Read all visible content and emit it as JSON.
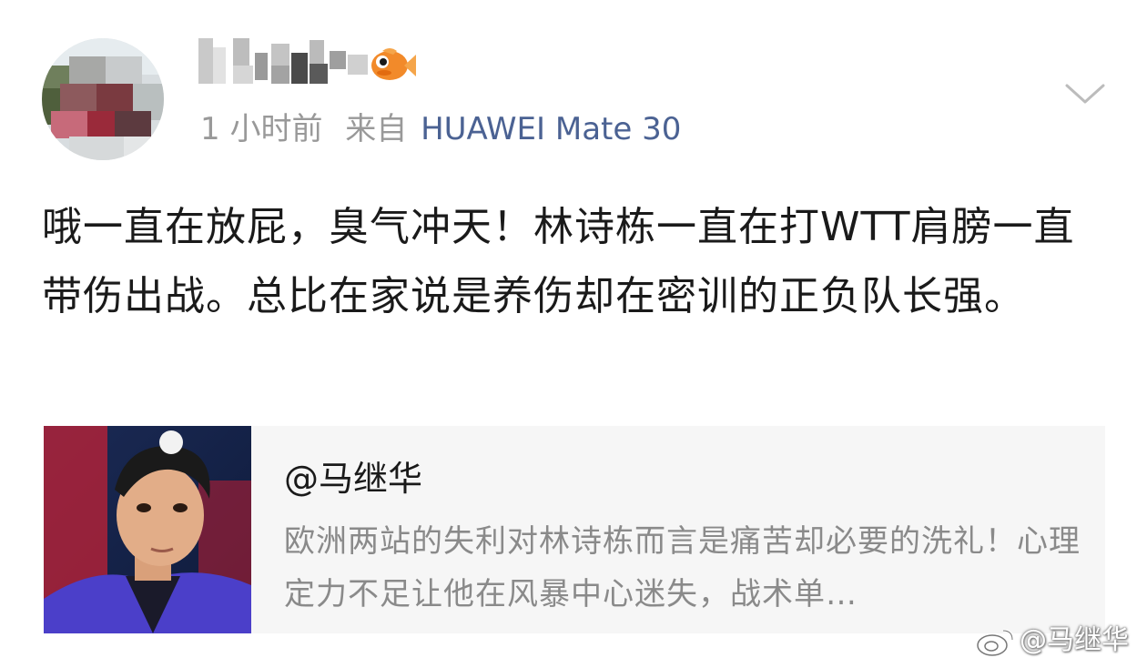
{
  "post": {
    "time": "1 小时前",
    "from_label": "来自",
    "device": "HUAWEI Mate 30",
    "body": "哦一直在放屁，臭气冲天！林诗栋一直在打WTT肩膀一直带伤出战。总比在家说是养伤却在密训的正负队长强。"
  },
  "quote": {
    "author": "@马继华",
    "text": "欧洲两站的失利对林诗栋而言是痛苦却必要的洗礼！心理定力不足让他在风暴中心迷失，战术单…"
  },
  "watermark": {
    "text": "@马继华"
  },
  "icons": {
    "badge": "fish-badge-icon",
    "more": "chevron-down-icon",
    "watermark": "weibo-logo-icon"
  },
  "colors": {
    "device_link": "#4b6293",
    "meta_gray": "#999999",
    "card_bg": "#f6f6f6"
  }
}
